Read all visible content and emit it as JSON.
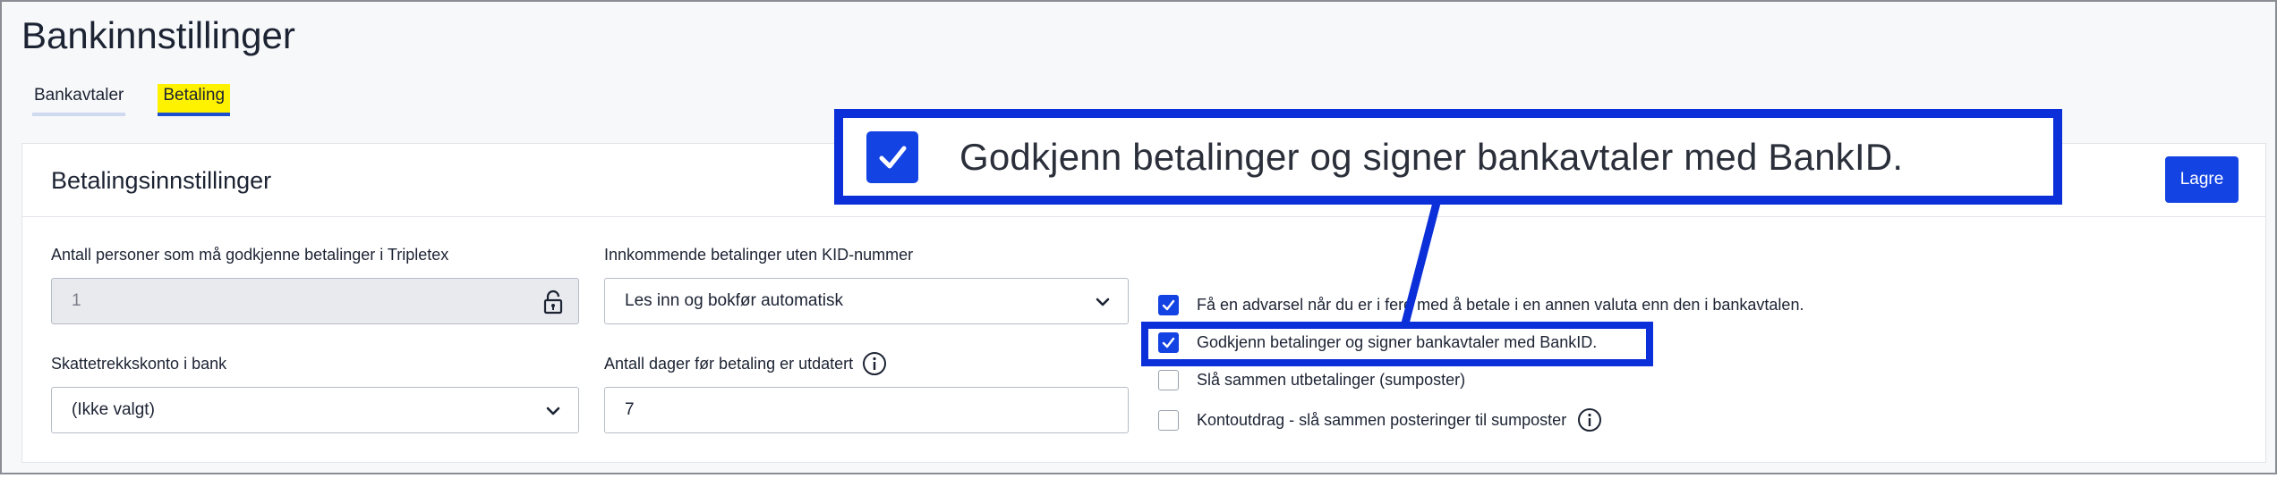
{
  "page": {
    "title": "Bankinnstillinger"
  },
  "tabs": [
    {
      "label": "Bankavtaler",
      "active": false
    },
    {
      "label": "Betaling",
      "active": true
    }
  ],
  "card": {
    "title": "Betalingsinnstillinger",
    "save_label": "Lagre"
  },
  "fields": {
    "approvers": {
      "label": "Antall personer som må godkjenne betalinger i Tripletex",
      "value": "1",
      "icon": "lock-icon"
    },
    "incoming": {
      "label": "Innkommende betalinger uten KID-nummer",
      "value": "Les inn og bokfør automatisk",
      "icon": "chevron-down-icon"
    },
    "tax_account": {
      "label": "Skattetrekkskonto i bank",
      "value": "(Ikke valgt)",
      "icon": "chevron-down-icon"
    },
    "days_outdated": {
      "label": "Antall dager før betaling er utdatert",
      "value": "7",
      "icon": "info-icon"
    }
  },
  "checkboxes": [
    {
      "label": "Få en advarsel når du er i ferd med å betale i en annen valuta enn den i bankavtalen.",
      "checked": true
    },
    {
      "label": "Godkjenn betalinger og signer bankavtaler med BankID.",
      "checked": true
    },
    {
      "label": "Slå sammen utbetalinger (sumposter)",
      "checked": false
    },
    {
      "label": "Kontoutdrag - slå sammen posteringer til sumposter",
      "checked": false,
      "icon": "info-icon"
    }
  ],
  "callout": {
    "text": "Godkjenn betalinger og signer bankavtaler med BankID.",
    "checked": true
  },
  "colors": {
    "accent": "#1443e3",
    "highlight": "#fff200",
    "annotation": "#0b2fd8"
  }
}
